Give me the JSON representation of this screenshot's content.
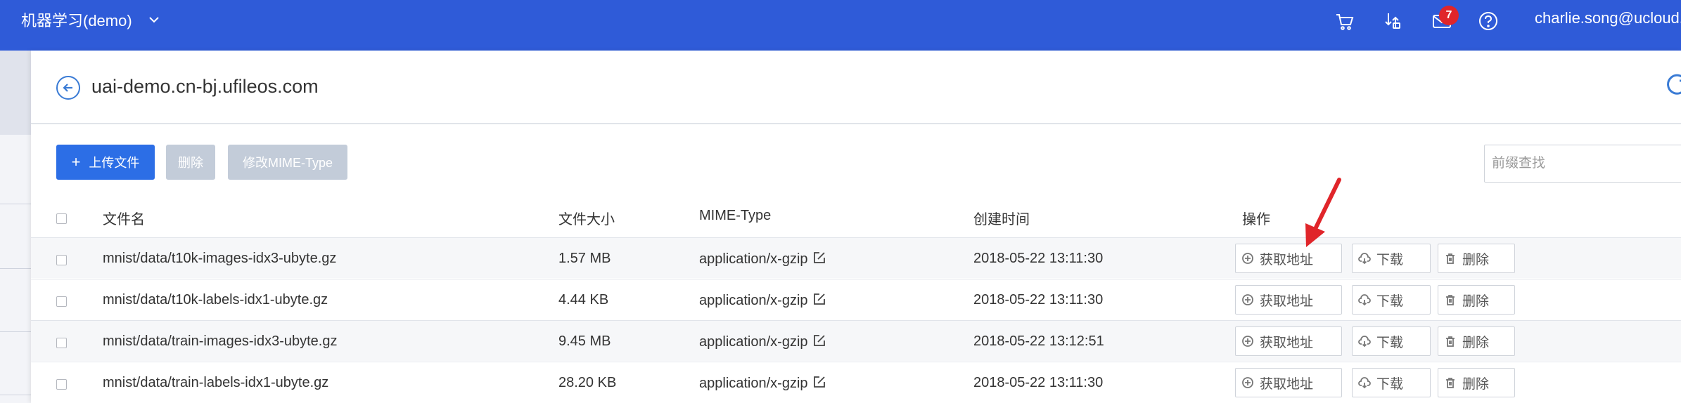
{
  "topbar": {
    "project_name": "机器学习(demo)",
    "message_count": "7",
    "user_email": "charlie.song@ucloud.cn"
  },
  "header": {
    "bucket_domain": "uai-demo.cn-bj.ufileos.com"
  },
  "toolbar": {
    "upload_label": "上传文件",
    "delete_label": "删除",
    "modify_mime_label": "修改MIME-Type",
    "search_placeholder": "前缀查找"
  },
  "table": {
    "columns": [
      "文件名",
      "文件大小",
      "MIME-Type",
      "创建时间",
      "操作"
    ],
    "rows": [
      {
        "name": "mnist/data/t10k-images-idx3-ubyte.gz",
        "size": "1.57 MB",
        "mime": "application/x-gzip",
        "created": "2018-05-22 13:11:30"
      },
      {
        "name": "mnist/data/t10k-labels-idx1-ubyte.gz",
        "size": "4.44 KB",
        "mime": "application/x-gzip",
        "created": "2018-05-22 13:11:30"
      },
      {
        "name": "mnist/data/train-images-idx3-ubyte.gz",
        "size": "9.45 MB",
        "mime": "application/x-gzip",
        "created": "2018-05-22 13:12:51"
      },
      {
        "name": "mnist/data/train-labels-idx1-ubyte.gz",
        "size": "28.20 KB",
        "mime": "application/x-gzip",
        "created": "2018-05-22 13:11:30"
      }
    ],
    "actions": {
      "get_url": "获取地址",
      "download": "下载",
      "delete": "删除"
    }
  },
  "colors": {
    "topbar": "#2f5bd8",
    "primary_button": "#2c6ee6",
    "disabled_button": "#c3ccd9",
    "badge": "#e0252a",
    "annotation_arrow": "#e0252a"
  }
}
